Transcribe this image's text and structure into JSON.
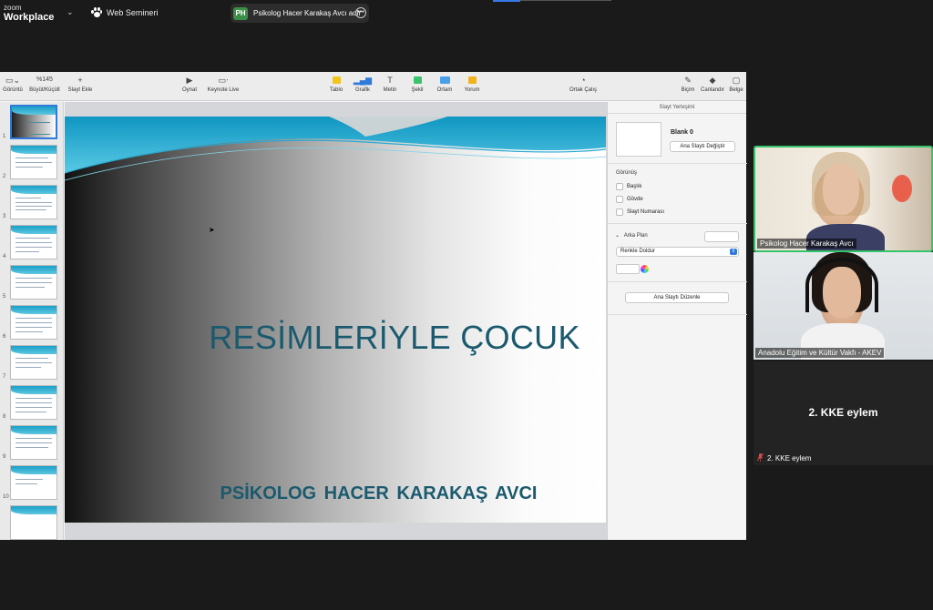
{
  "zoom": {
    "brand_top": "zoom",
    "brand_bottom": "Workplace",
    "webinar_label": "Web Semineri",
    "share_badge": "PH",
    "share_text": "Psikolog Hacer Karakaş Avcı adlı"
  },
  "toolbar": {
    "view_label": "Görüntü",
    "zoom_value": "%145",
    "zoom_label": "Büyüt/Küçült",
    "add_slide_label": "Slayt Ekle",
    "play_label": "Oynat",
    "keynote_live_label": "Keynote Live",
    "table_label": "Tablo",
    "chart_label": "Grafik",
    "text_label": "Metin",
    "shape_label": "Şekil",
    "media_label": "Ortam",
    "comment_label": "Yorum",
    "collab_label": "Ortak Çalış",
    "format_label": "Biçim",
    "animate_label": "Canlandır",
    "document_label": "Belge"
  },
  "thumbnails": [
    "1",
    "2",
    "3",
    "4",
    "5",
    "6",
    "7",
    "8",
    "9",
    "10"
  ],
  "slide": {
    "title": "RESİMLERİYLE ÇOCUK",
    "subtitle": "PSİKOLOG  HACER KARAKAŞ AVCI"
  },
  "inspector": {
    "header": "Slayt Yerleşimi",
    "master_name": "Blank 0",
    "change_master_button": "Ana Slaytı Değiştir",
    "appearance_label": "Görünüş",
    "checkbox_title": "Başlık",
    "checkbox_body": "Gövde",
    "checkbox_slide_number": "Slayt Numarası",
    "background_label": "Arka Plan",
    "fill_option": "Renkle Doldur",
    "edit_master_button": "Ana Slaytı Düzenle"
  },
  "participants": {
    "p1_name": "Psikolog Hacer Karakaş Avcı",
    "p2_name": "Anadolu Eğitim ve Kültür Vakfı - AKEV",
    "p3_display": "2. KKE eylem",
    "p3_label": "2. KKE eylem"
  },
  "colors": {
    "slide_text": "#1b5a6e",
    "wave_cyan": "#1aa0c8",
    "active_speaker": "#36c46a",
    "selection_blue": "#2f7ad9"
  }
}
